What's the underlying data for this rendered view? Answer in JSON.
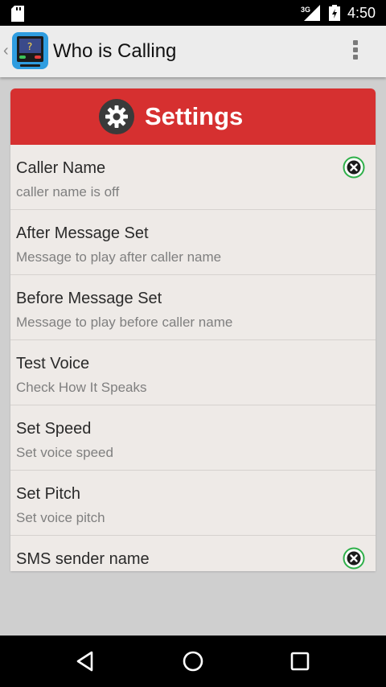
{
  "status_bar": {
    "network": "3G",
    "time": "4:50"
  },
  "action_bar": {
    "title": "Who is Calling"
  },
  "card": {
    "header": "Settings",
    "rows": [
      {
        "title": "Caller Name",
        "subtitle": "caller name is off",
        "toggle": "off"
      },
      {
        "title": "After Message Set",
        "subtitle": "Message to play after caller name"
      },
      {
        "title": "Before Message Set",
        "subtitle": "Message to play before caller name"
      },
      {
        "title": "Test Voice",
        "subtitle": "Check How It Speaks"
      },
      {
        "title": "Set Speed",
        "subtitle": "Set voice speed"
      },
      {
        "title": "Set Pitch",
        "subtitle": "Set voice pitch"
      },
      {
        "title": "SMS sender name",
        "subtitle": "",
        "toggle": "off"
      }
    ]
  },
  "colors": {
    "header_red": "#d63030",
    "toggle_green": "#2fb04a",
    "card_bg": "#eeeae7"
  },
  "icons": {
    "status": [
      "sd-card-icon",
      "signal-icon",
      "battery-icon"
    ],
    "nav": [
      "back-triangle-icon",
      "home-circle-icon",
      "recents-square-icon"
    ]
  }
}
